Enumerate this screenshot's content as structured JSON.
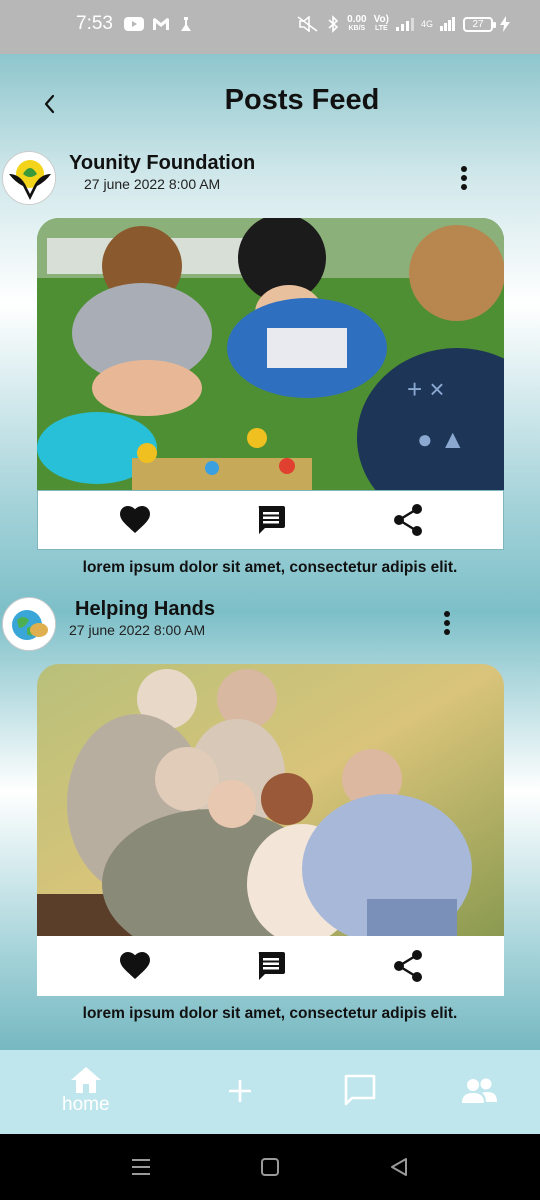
{
  "status_bar": {
    "time": "7:53",
    "speed_value": "0.00",
    "speed_unit": "KB/S",
    "volte_top": "Vo)",
    "volte_bottom": "LTE",
    "network": "4G",
    "battery": "27"
  },
  "header": {
    "title": "Posts Feed"
  },
  "posts": [
    {
      "user": "Younity Foundation",
      "date": "27 june 2022  8:00 AM",
      "caption": "lorem ipsum dolor sit amet, consectetur adipis elit."
    },
    {
      "user": "Helping Hands",
      "date": "27 june 2022  8:00 AM",
      "caption": "lorem ipsum dolor sit amet, consectetur adipis elit."
    }
  ],
  "bottom_nav": {
    "home_label": "home"
  },
  "icons": {
    "back": "chevron-left-icon",
    "more": "more-vertical-icon",
    "like": "heart-icon",
    "comment": "comment-icon",
    "share": "share-icon",
    "home": "home-icon",
    "add": "plus-icon",
    "chat": "chat-icon",
    "people": "people-icon"
  },
  "colors": {
    "status_bar": "#b7b7b7",
    "bottom_nav": "#bfe6ec",
    "accent_teal": "#7dbfc8"
  }
}
